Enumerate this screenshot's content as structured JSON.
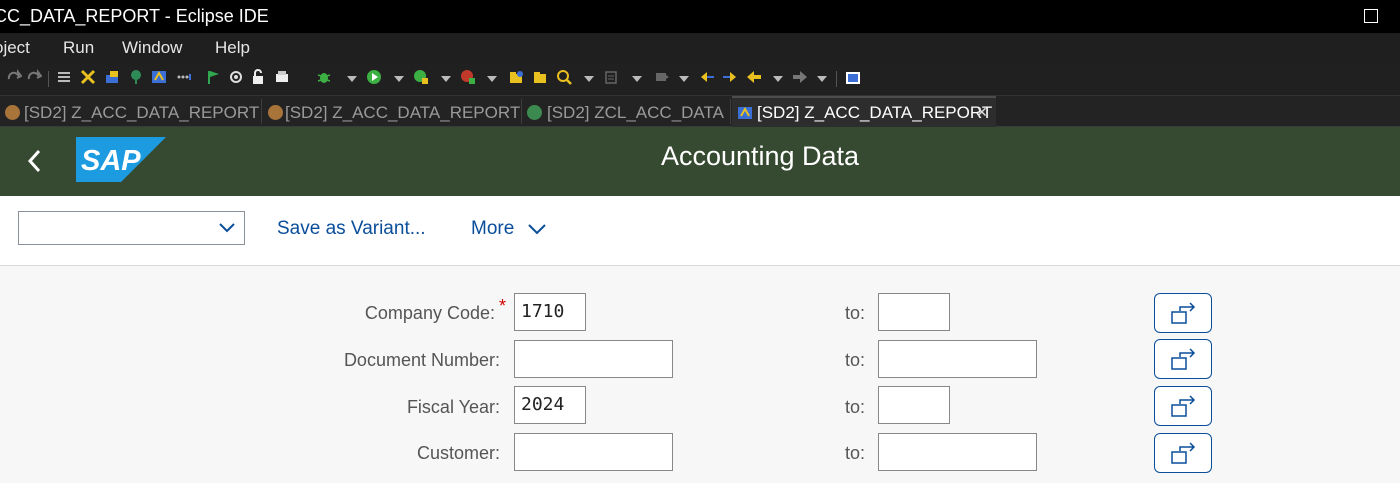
{
  "window": {
    "title": "CC_DATA_REPORT - Eclipse IDE"
  },
  "menu": [
    "oject",
    "Run",
    "Window",
    "Help"
  ],
  "tabs": [
    {
      "label": "[SD2] Z_ACC_DATA_REPORT",
      "icon": "program-icon"
    },
    {
      "label": "[SD2] Z_ACC_DATA_REPORT",
      "icon": "program-icon"
    },
    {
      "label": "[SD2] ZCL_ACC_DATA",
      "icon": "class-icon"
    },
    {
      "label": "[SD2] Z_ACC_DATA_REPORT",
      "icon": "sap-gui-icon",
      "active": true,
      "close": "✕"
    }
  ],
  "shell": {
    "logo": "SAP",
    "title": "Accounting Data",
    "back_icon": "chevron-left-icon"
  },
  "variant": {
    "selected": "",
    "save_as_variant": "Save as Variant...",
    "more": "More"
  },
  "form": {
    "company_code": {
      "label": "Company Code:",
      "required": "*",
      "from": "1710",
      "to_label": "to:",
      "to": ""
    },
    "document_number": {
      "label": "Document Number:",
      "from": "",
      "to_label": "to:",
      "to": ""
    },
    "fiscal_year": {
      "label": "Fiscal Year:",
      "from": "2024",
      "to_label": "to:",
      "to": ""
    },
    "customer": {
      "label": "Customer:",
      "from": "",
      "to_label": "to:",
      "to": ""
    }
  },
  "colors": {
    "shell_bg": "#354a30",
    "link": "#0a4e9a",
    "required": "#cc0000"
  }
}
